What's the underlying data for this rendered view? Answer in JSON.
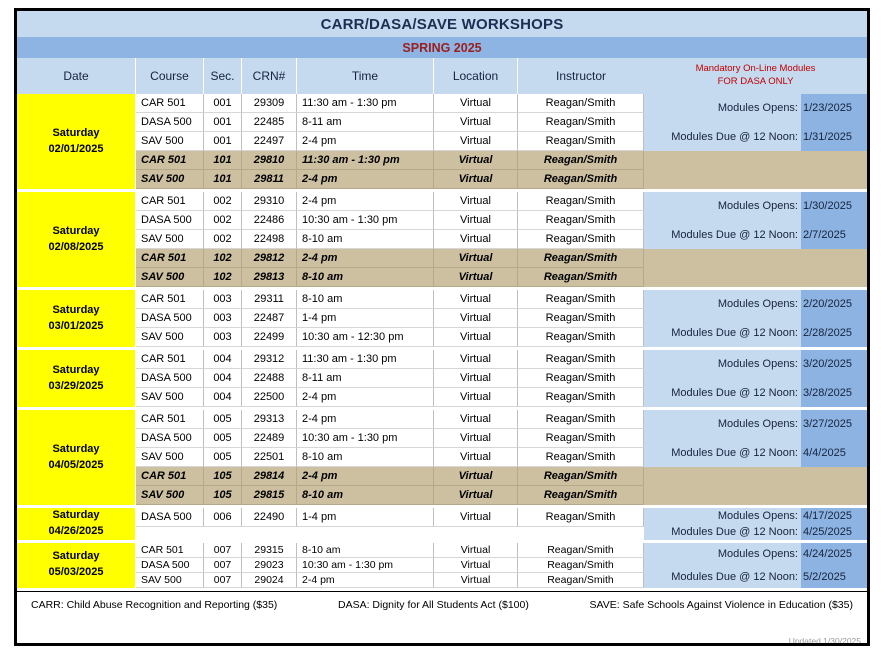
{
  "header": {
    "title": "CARR/DASA/SAVE WORKSHOPS",
    "term": "SPRING 2025",
    "columns": {
      "date": "Date",
      "course": "Course",
      "sec": "Sec.",
      "crn": "CRN#",
      "time": "Time",
      "location": "Location",
      "instructor": "Instructor"
    },
    "modules_header_line1": "Mandatory On-Line Modules",
    "modules_header_line2": "FOR DASA ONLY"
  },
  "labels": {
    "opens": "Modules Opens:",
    "due": "Modules Due @ 12 Noon:"
  },
  "groups": [
    {
      "day": "Saturday",
      "date": "02/01/2025",
      "modules_open": "1/23/2025",
      "modules_due": "1/31/2025",
      "rows": [
        {
          "course": "CAR 501",
          "sec": "001",
          "crn": "29309",
          "time": "11:30 am - 1:30 pm",
          "location": "Virtual",
          "instructor": "Reagan/Smith",
          "overflow": false
        },
        {
          "course": "DASA 500",
          "sec": "001",
          "crn": "22485",
          "time": "8-11 am",
          "location": "Virtual",
          "instructor": "Reagan/Smith",
          "overflow": false
        },
        {
          "course": "SAV 500",
          "sec": "001",
          "crn": "22497",
          "time": "2-4 pm",
          "location": "Virtual",
          "instructor": "Reagan/Smith",
          "overflow": false
        },
        {
          "course": "CAR 501",
          "sec": "101",
          "crn": "29810",
          "time": "11:30 am - 1:30 pm",
          "location": "Virtual",
          "instructor": "Reagan/Smith",
          "overflow": true
        },
        {
          "course": "SAV 500",
          "sec": "101",
          "crn": "29811",
          "time": "2-4 pm",
          "location": "Virtual",
          "instructor": "Reagan/Smith",
          "overflow": true
        }
      ]
    },
    {
      "day": "Saturday",
      "date": "02/08/2025",
      "modules_open": "1/30/2025",
      "modules_due": "2/7/2025",
      "rows": [
        {
          "course": "CAR 501",
          "sec": "002",
          "crn": "29310",
          "time": "2-4 pm",
          "location": "Virtual",
          "instructor": "Reagan/Smith",
          "overflow": false
        },
        {
          "course": "DASA 500",
          "sec": "002",
          "crn": "22486",
          "time": "10:30 am - 1:30 pm",
          "location": "Virtual",
          "instructor": "Reagan/Smith",
          "overflow": false
        },
        {
          "course": "SAV 500",
          "sec": "002",
          "crn": "22498",
          "time": "8-10 am",
          "location": "Virtual",
          "instructor": "Reagan/Smith",
          "overflow": false
        },
        {
          "course": "CAR 501",
          "sec": "102",
          "crn": "29812",
          "time": "2-4 pm",
          "location": "Virtual",
          "instructor": "Reagan/Smith",
          "overflow": true
        },
        {
          "course": "SAV 500",
          "sec": "102",
          "crn": "29813",
          "time": "8-10 am",
          "location": "Virtual",
          "instructor": "Reagan/Smith",
          "overflow": true
        }
      ]
    },
    {
      "day": "Saturday",
      "date": "03/01/2025",
      "modules_open": "2/20/2025",
      "modules_due": "2/28/2025",
      "rows": [
        {
          "course": "CAR 501",
          "sec": "003",
          "crn": "29311",
          "time": "8-10 am",
          "location": "Virtual",
          "instructor": "Reagan/Smith",
          "overflow": false
        },
        {
          "course": "DASA 500",
          "sec": "003",
          "crn": "22487",
          "time": "1-4 pm",
          "location": "Virtual",
          "instructor": "Reagan/Smith",
          "overflow": false
        },
        {
          "course": "SAV 500",
          "sec": "003",
          "crn": "22499",
          "time": "10:30 am - 12:30 pm",
          "location": "Virtual",
          "instructor": "Reagan/Smith",
          "overflow": false
        }
      ]
    },
    {
      "day": "Saturday",
      "date": "03/29/2025",
      "modules_open": "3/20/2025",
      "modules_due": "3/28/2025",
      "rows": [
        {
          "course": "CAR 501",
          "sec": "004",
          "crn": "29312",
          "time": "11:30 am - 1:30 pm",
          "location": "Virtual",
          "instructor": "Reagan/Smith",
          "overflow": false
        },
        {
          "course": "DASA 500",
          "sec": "004",
          "crn": "22488",
          "time": "8-11 am",
          "location": "Virtual",
          "instructor": "Reagan/Smith",
          "overflow": false
        },
        {
          "course": "SAV 500",
          "sec": "004",
          "crn": "22500",
          "time": "2-4 pm",
          "location": "Virtual",
          "instructor": "Reagan/Smith",
          "overflow": false
        }
      ]
    },
    {
      "day": "Saturday",
      "date": "04/05/2025",
      "modules_open": "3/27/2025",
      "modules_due": "4/4/2025",
      "rows": [
        {
          "course": "CAR 501",
          "sec": "005",
          "crn": "29313",
          "time": "2-4 pm",
          "location": "Virtual",
          "instructor": "Reagan/Smith",
          "overflow": false
        },
        {
          "course": "DASA 500",
          "sec": "005",
          "crn": "22489",
          "time": "10:30 am - 1:30 pm",
          "location": "Virtual",
          "instructor": "Reagan/Smith",
          "overflow": false
        },
        {
          "course": "SAV 500",
          "sec": "005",
          "crn": "22501",
          "time": "8-10 am",
          "location": "Virtual",
          "instructor": "Reagan/Smith",
          "overflow": false
        },
        {
          "course": "CAR 501",
          "sec": "105",
          "crn": "29814",
          "time": "2-4 pm",
          "location": "Virtual",
          "instructor": "Reagan/Smith",
          "overflow": true
        },
        {
          "course": "SAV 500",
          "sec": "105",
          "crn": "29815",
          "time": "8-10 am",
          "location": "Virtual",
          "instructor": "Reagan/Smith",
          "overflow": true
        }
      ]
    },
    {
      "day": "Saturday",
      "date": "04/26/2025",
      "modules_open": "4/17/2025",
      "modules_due": "4/25/2025",
      "rows": [
        {
          "course": "DASA 500",
          "sec": "006",
          "crn": "22490",
          "time": "1-4 pm",
          "location": "Virtual",
          "instructor": "Reagan/Smith",
          "overflow": false
        }
      ]
    },
    {
      "day": "Saturday",
      "date": "05/03/2025",
      "modules_open": "4/24/2025",
      "modules_due": "5/2/2025",
      "rows": [
        {
          "course": "CAR 501",
          "sec": "007",
          "crn": "29315",
          "time": "8-10 am",
          "location": "Virtual",
          "instructor": "Reagan/Smith",
          "overflow": false
        },
        {
          "course": "DASA 500",
          "sec": "007",
          "crn": "29023",
          "time": "10:30 am - 1:30 pm",
          "location": "Virtual",
          "instructor": "Reagan/Smith",
          "overflow": false
        },
        {
          "course": "SAV 500",
          "sec": "007",
          "crn": "29024",
          "time": "2-4 pm",
          "location": "Virtual",
          "instructor": "Reagan/Smith",
          "overflow": false
        }
      ]
    }
  ],
  "footer": {
    "carr": "CARR: Child Abuse Recognition and Reporting ($35)",
    "dasa": "DASA: Dignity for All Students Act ($100)",
    "save": "SAVE: Safe Schools Against Violence in Education ($35)",
    "updated": "Updated 1/30/2025"
  },
  "colors": {
    "title_band": "#c5d9ef",
    "term_band": "#8eb4e3",
    "term_text": "#992020",
    "date_cell": "#ffff00",
    "overflow_row": "#cdc0a0",
    "module_label": "#c5d9ef",
    "module_value": "#8db3e2",
    "module_header_text": "#c00000"
  }
}
